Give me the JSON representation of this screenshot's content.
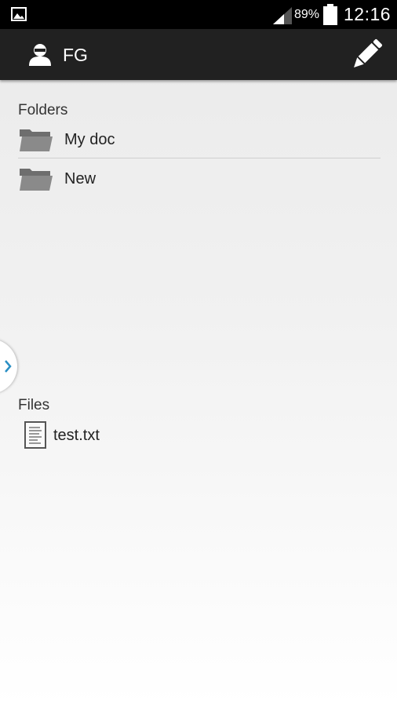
{
  "status_bar": {
    "battery_percent": "89%",
    "time": "12:16"
  },
  "action_bar": {
    "account_name": "FG"
  },
  "folders": {
    "heading": "Folders",
    "items": [
      {
        "label": "My doc"
      },
      {
        "label": "New"
      }
    ]
  },
  "files": {
    "heading": "Files",
    "items": [
      {
        "label": "test.txt"
      }
    ]
  },
  "icons": {
    "status_left": "gallery-icon",
    "signal": "signal-icon",
    "battery": "battery-icon",
    "account": "user-icon",
    "edit": "pencil-icon",
    "folder": "folder-icon",
    "file": "text-file-icon",
    "drawer": "chevron-right-icon"
  },
  "colors": {
    "action_bar": "#212121",
    "status_bar": "#000000",
    "drawer_chevron": "#2a8fc4",
    "folder_icon": "#7a7a7a"
  }
}
